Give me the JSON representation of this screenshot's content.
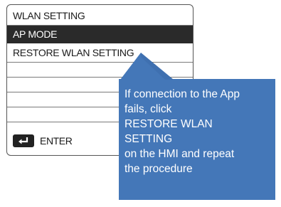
{
  "menu": {
    "title": "WLAN SETTING",
    "items": [
      {
        "label": "AP MODE",
        "selected": true
      },
      {
        "label": "RESTORE WLAN SETTING",
        "selected": false
      }
    ]
  },
  "footer": {
    "enter_label": "ENTER",
    "enter_icon": "enter-key-icon"
  },
  "callout": {
    "lines": [
      "If connection to the App",
      "fails, click",
      "RESTORE WLAN",
      "SETTING",
      "on the HMI and repeat",
      "the procedure"
    ],
    "background": "#4477b8",
    "text_color": "#ffffff"
  },
  "colors": {
    "selected_row_bg": "#2a2a2a",
    "border": "#555555"
  }
}
